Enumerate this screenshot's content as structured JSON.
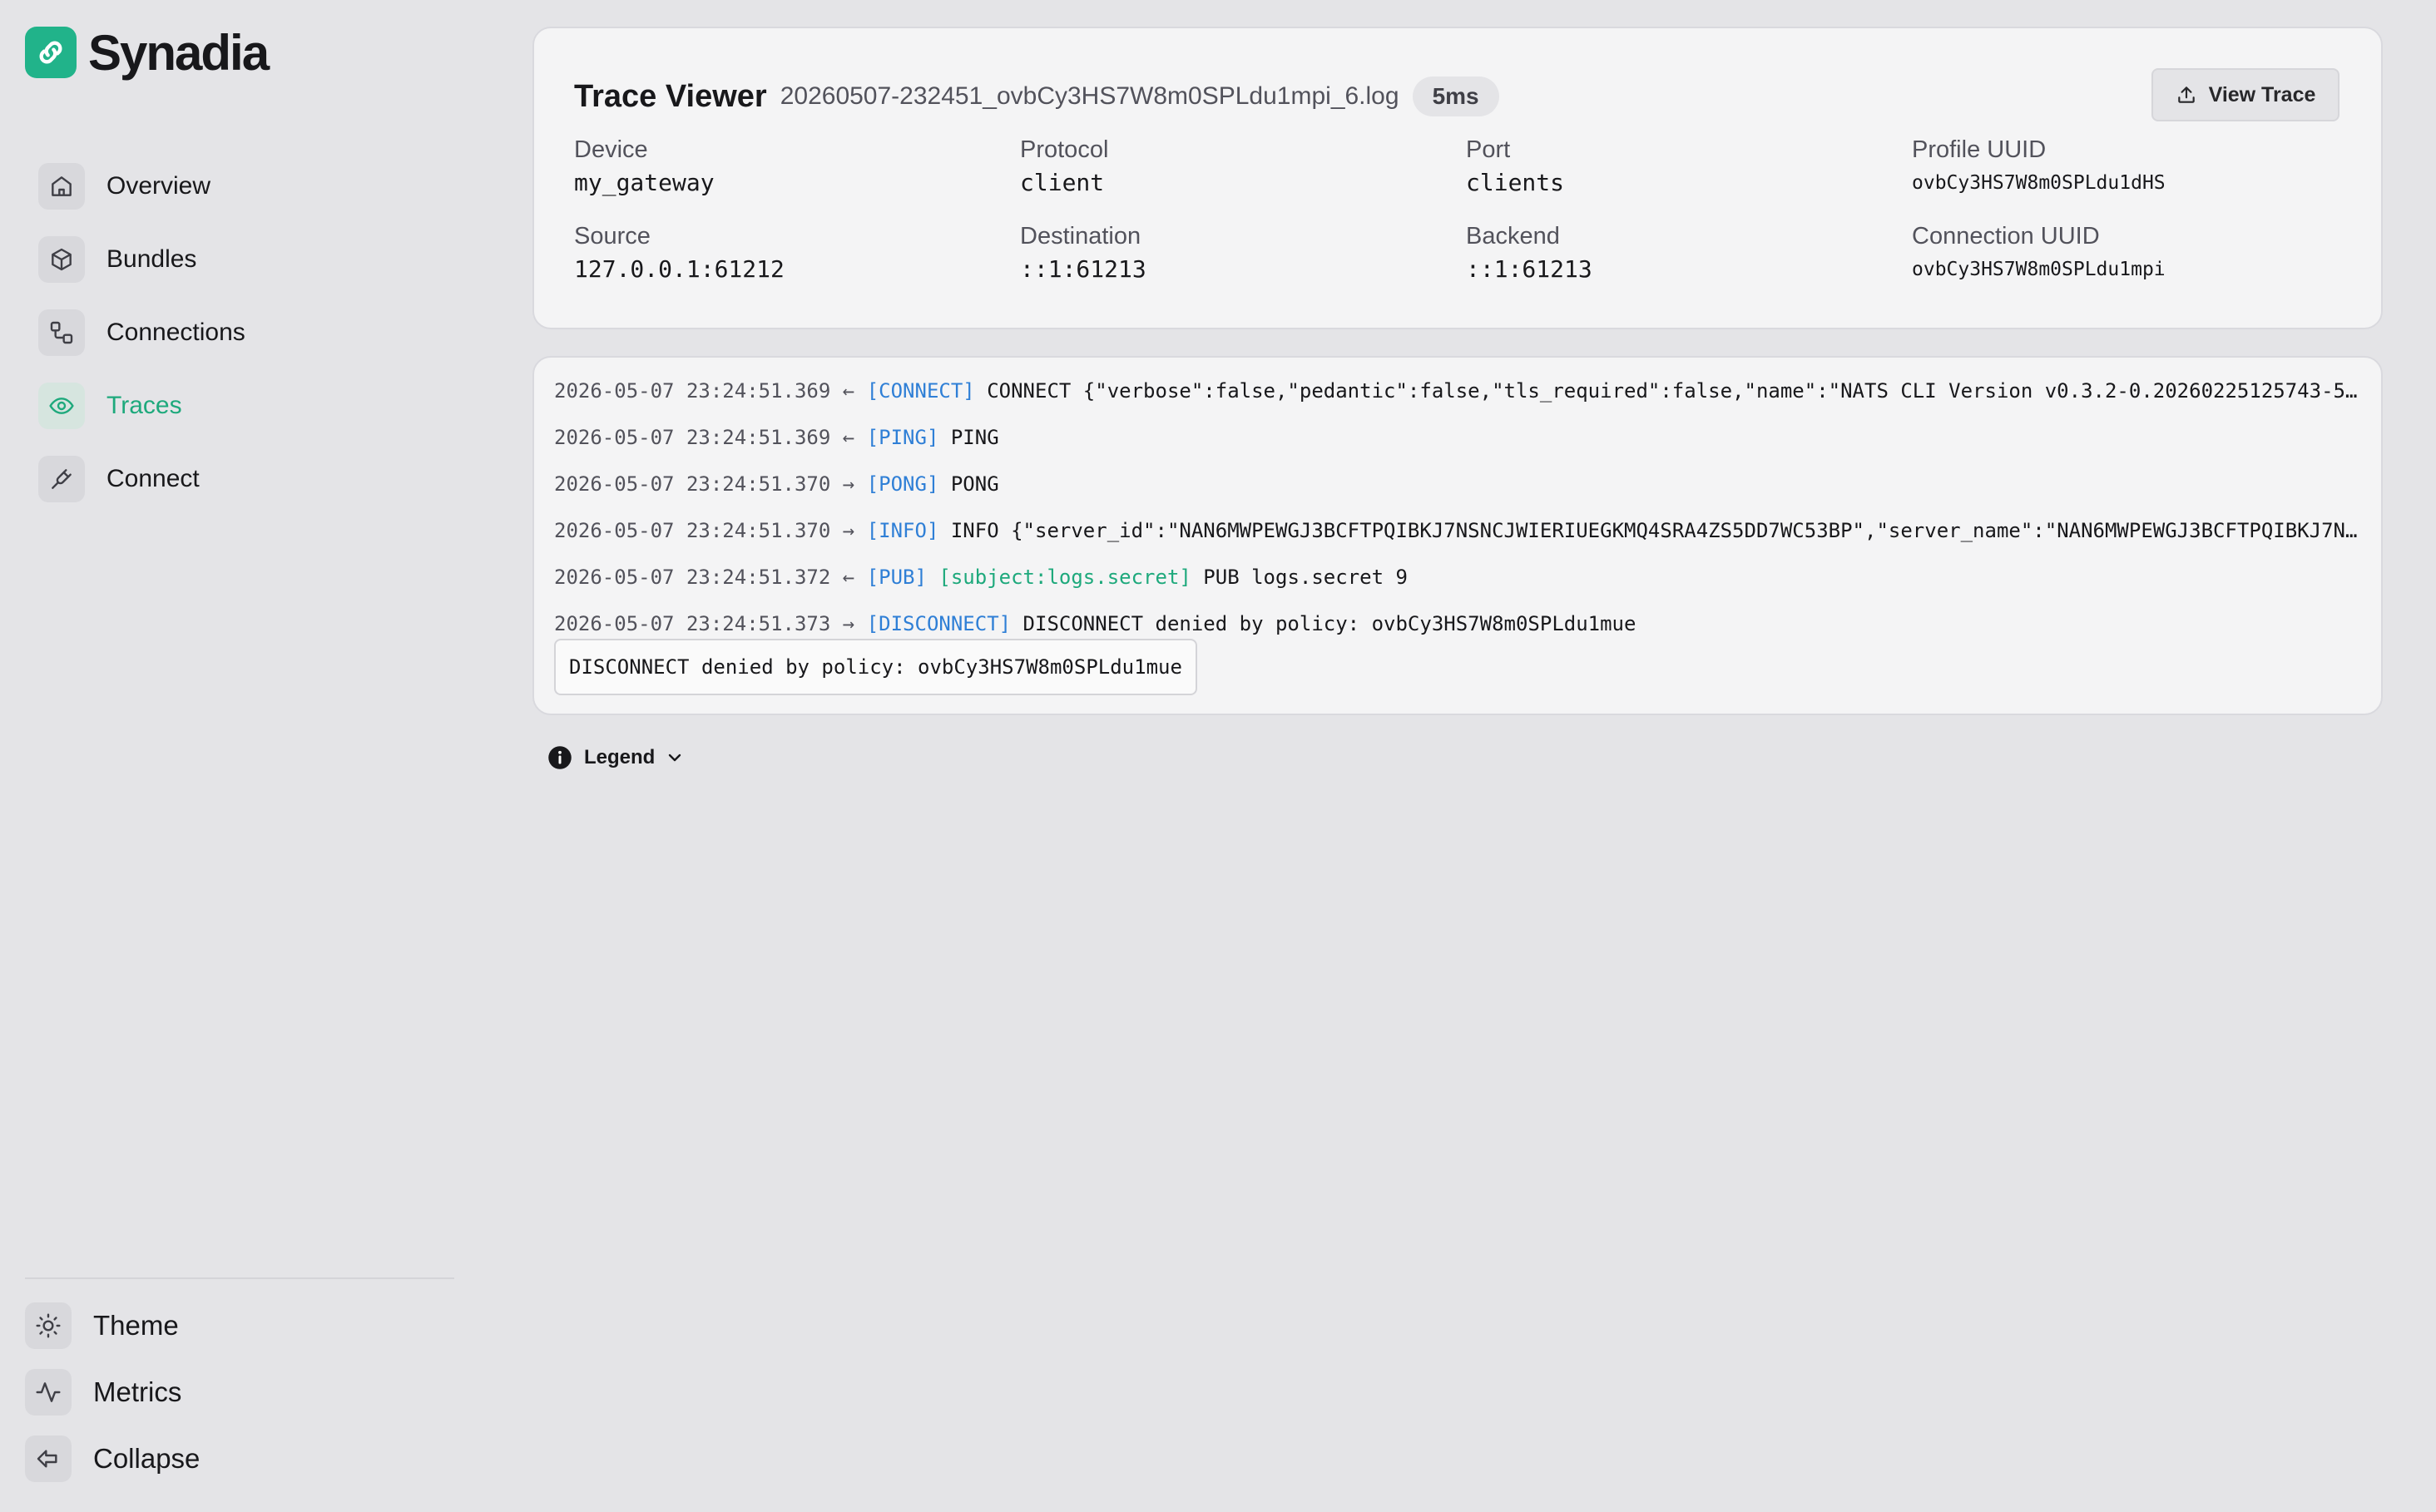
{
  "brand": {
    "name": "Synadia"
  },
  "nav": {
    "items": [
      {
        "label": "Overview",
        "icon": "home-icon",
        "active": false
      },
      {
        "label": "Bundles",
        "icon": "package-icon",
        "active": false
      },
      {
        "label": "Connections",
        "icon": "connections-icon",
        "active": false
      },
      {
        "label": "Traces",
        "icon": "eye-icon",
        "active": true
      },
      {
        "label": "Connect",
        "icon": "plug-icon",
        "active": false
      }
    ],
    "bottom": [
      {
        "label": "Theme",
        "icon": "sun-icon"
      },
      {
        "label": "Metrics",
        "icon": "activity-icon"
      },
      {
        "label": "Collapse",
        "icon": "collapse-icon"
      }
    ]
  },
  "trace": {
    "title": "Trace Viewer",
    "file": "20260507-232451_ovbCy3HS7W8m0SPLdu1mpi_6.log",
    "duration": "5ms",
    "view_button": "View Trace",
    "meta": {
      "device_label": "Device",
      "device_value": "my_gateway",
      "protocol_label": "Protocol",
      "protocol_value": "client",
      "port_label": "Port",
      "port_value": "clients",
      "profile_uuid_label": "Profile UUID",
      "profile_uuid_value": "ovbCy3HS7W8m0SPLdu1dHS",
      "source_label": "Source",
      "source_value": "127.0.0.1:61212",
      "destination_label": "Destination",
      "destination_value": "::1:61213",
      "backend_label": "Backend",
      "backend_value": "::1:61213",
      "connection_uuid_label": "Connection UUID",
      "connection_uuid_value": "ovbCy3HS7W8m0SPLdu1mpi"
    }
  },
  "log": {
    "lines": [
      {
        "time": "2026-05-07 23:24:51.369",
        "dir": "←",
        "tag": "[CONNECT]",
        "subject": "",
        "text": "CONNECT {\"verbose\":false,\"pedantic\":false,\"tls_required\":false,\"name\":\"NATS CLI Version v0.3.2-0.20260225125743-5…"
      },
      {
        "time": "2026-05-07 23:24:51.369",
        "dir": "←",
        "tag": "[PING]",
        "subject": "",
        "text": "PING"
      },
      {
        "time": "2026-05-07 23:24:51.370",
        "dir": "→",
        "tag": "[PONG]",
        "subject": "",
        "text": "PONG"
      },
      {
        "time": "2026-05-07 23:24:51.370",
        "dir": "→",
        "tag": "[INFO]",
        "subject": "",
        "text": "INFO {\"server_id\":\"NAN6MWPEWGJ3BCFTPQIBKJ7NSNCJWIERIUEGKMQ4SRA4ZS5DD7WC53BP\",\"server_name\":\"NAN6MWPEWGJ3BCFTPQIBKJ7N…"
      },
      {
        "time": "2026-05-07 23:24:51.372",
        "dir": "←",
        "tag": "[PUB]",
        "subject": "[subject:logs.secret]",
        "text": "PUB logs.secret 9"
      },
      {
        "time": "2026-05-07 23:24:51.373",
        "dir": "→",
        "tag": "[DISCONNECT]",
        "subject": "",
        "text": "DISCONNECT denied by policy: ovbCy3HS7W8m0SPLdu1mue"
      }
    ],
    "detail": "DISCONNECT denied by policy: ovbCy3HS7W8m0SPLdu1mue"
  },
  "legend": {
    "label": "Legend"
  },
  "colors": {
    "accent": "#1ea97c",
    "brand": "#21b38a",
    "tag": "#2f7fd6"
  }
}
